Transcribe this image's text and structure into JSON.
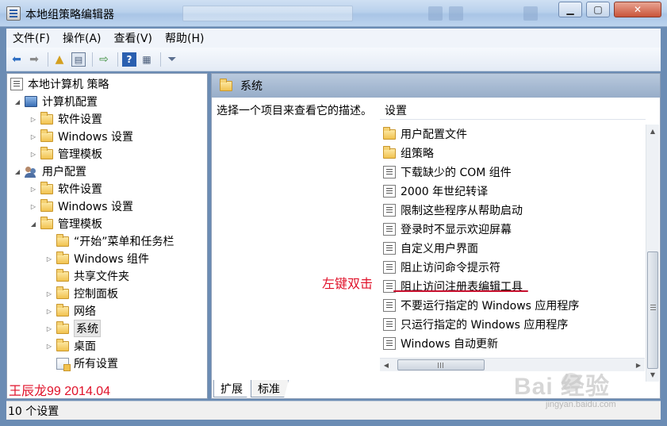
{
  "window": {
    "title": "本地组策略编辑器",
    "min_label": "▭",
    "max_label": "□",
    "close_label": "✕"
  },
  "menu": {
    "items": [
      "文件(F)",
      "操作(A)",
      "查看(V)",
      "帮助(H)"
    ]
  },
  "toolbar": {
    "icons": [
      "back-arrow-icon",
      "forward-arrow-icon",
      "up-folder-icon",
      "show-hide-tree-icon",
      "export-list-icon",
      "help-icon",
      "properties-icon",
      "filter-icon"
    ]
  },
  "tree": {
    "root": "本地计算机 策略",
    "computer_config": "计算机配置",
    "cc_software": "软件设置",
    "cc_windows": "Windows 设置",
    "cc_admin": "管理模板",
    "user_config": "用户配置",
    "uc_software": "软件设置",
    "uc_windows": "Windows 设置",
    "uc_admin": "管理模板",
    "start_menu": "“开始”菜单和任务栏",
    "win_components": "Windows 组件",
    "shared_folders": "共享文件夹",
    "control_panel": "控制面板",
    "network": "网络",
    "system": "系统",
    "desktop": "桌面",
    "all_settings": "所有设置"
  },
  "right": {
    "header_title": "系统",
    "description": "选择一个项目来查看它的描述。",
    "column_header": "设置",
    "items": [
      {
        "label": "用户配置文件",
        "type": "folder"
      },
      {
        "label": "组策略",
        "type": "folder"
      },
      {
        "label": "下载缺少的 COM 组件",
        "type": "policy"
      },
      {
        "label": "2000 年世纪转译",
        "type": "policy"
      },
      {
        "label": "限制这些程序从帮助启动",
        "type": "policy"
      },
      {
        "label": "登录时不显示欢迎屏幕",
        "type": "policy"
      },
      {
        "label": "自定义用户界面",
        "type": "policy"
      },
      {
        "label": "阻止访问命令提示符",
        "type": "policy"
      },
      {
        "label": "阻止访问注册表编辑工具",
        "type": "policy"
      },
      {
        "label": "不要运行指定的 Windows 应用程序",
        "type": "policy"
      },
      {
        "label": "只运行指定的 Windows 应用程序",
        "type": "policy"
      },
      {
        "label": "Windows 自动更新",
        "type": "policy"
      }
    ],
    "tabs": [
      "扩展",
      "标准"
    ]
  },
  "annotation": {
    "text": "左键双击",
    "color": "#e0122a"
  },
  "author_watermark": "王辰龙99 2014.04",
  "status": {
    "text": "10 个设置"
  },
  "baidu_watermark": {
    "brand": "Bai  经验",
    "url": "jingyan.baidu.com"
  }
}
